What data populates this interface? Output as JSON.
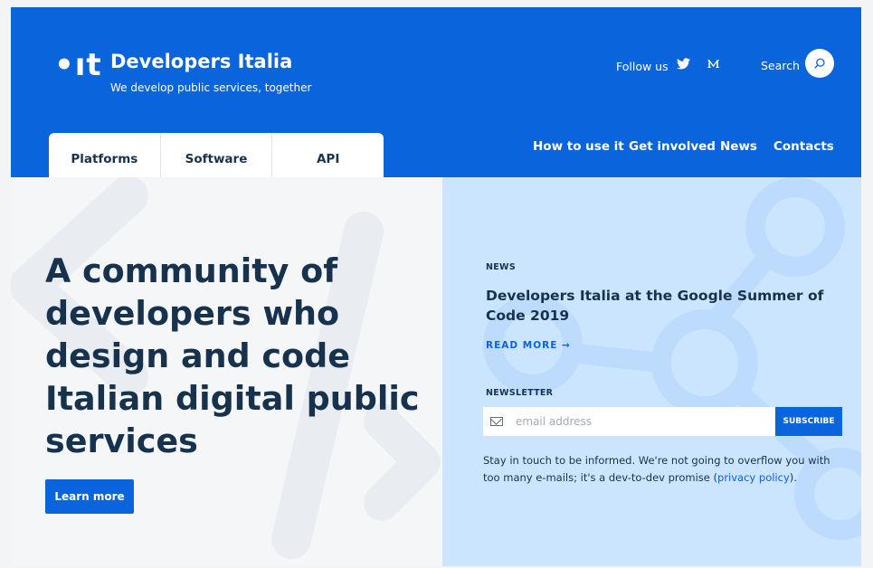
{
  "header": {
    "logo_mark": "•ıt",
    "title": "Developers Italia",
    "subtitle": "We develop public services, together",
    "follow_label": "Follow us",
    "search_label": "Search"
  },
  "tabs": [
    {
      "label": "Platforms"
    },
    {
      "label": "Software"
    },
    {
      "label": "API"
    }
  ],
  "nav": [
    {
      "label": "How to use it"
    },
    {
      "label": "Get involved"
    },
    {
      "label": "News"
    },
    {
      "label": "Contacts"
    }
  ],
  "hero": {
    "headline": "A community of developers who design and code Italian digital public services",
    "button_label": "Learn more"
  },
  "news": {
    "section_label": "NEWS",
    "title": "Developers Italia at the Google Summer of Code 2019",
    "read_more": "READ MORE →"
  },
  "newsletter": {
    "section_label": "NEWSLETTER",
    "placeholder": "email address",
    "subscribe_label": "SUBSCRIBE",
    "note_text": "Stay in touch to be informed. We're not going to overflow you with too many e-mails; it's a dev-to-dev promise (",
    "privacy_link": "privacy policy",
    "note_end": ")."
  },
  "colors": {
    "brand_blue": "#0a64db",
    "dark_text": "#17324d",
    "light_blue_panel": "#cbe4ff"
  },
  "icons": {
    "twitter": "twitter-icon",
    "medium": "medium-icon",
    "search": "search-icon",
    "email": "email-icon"
  }
}
